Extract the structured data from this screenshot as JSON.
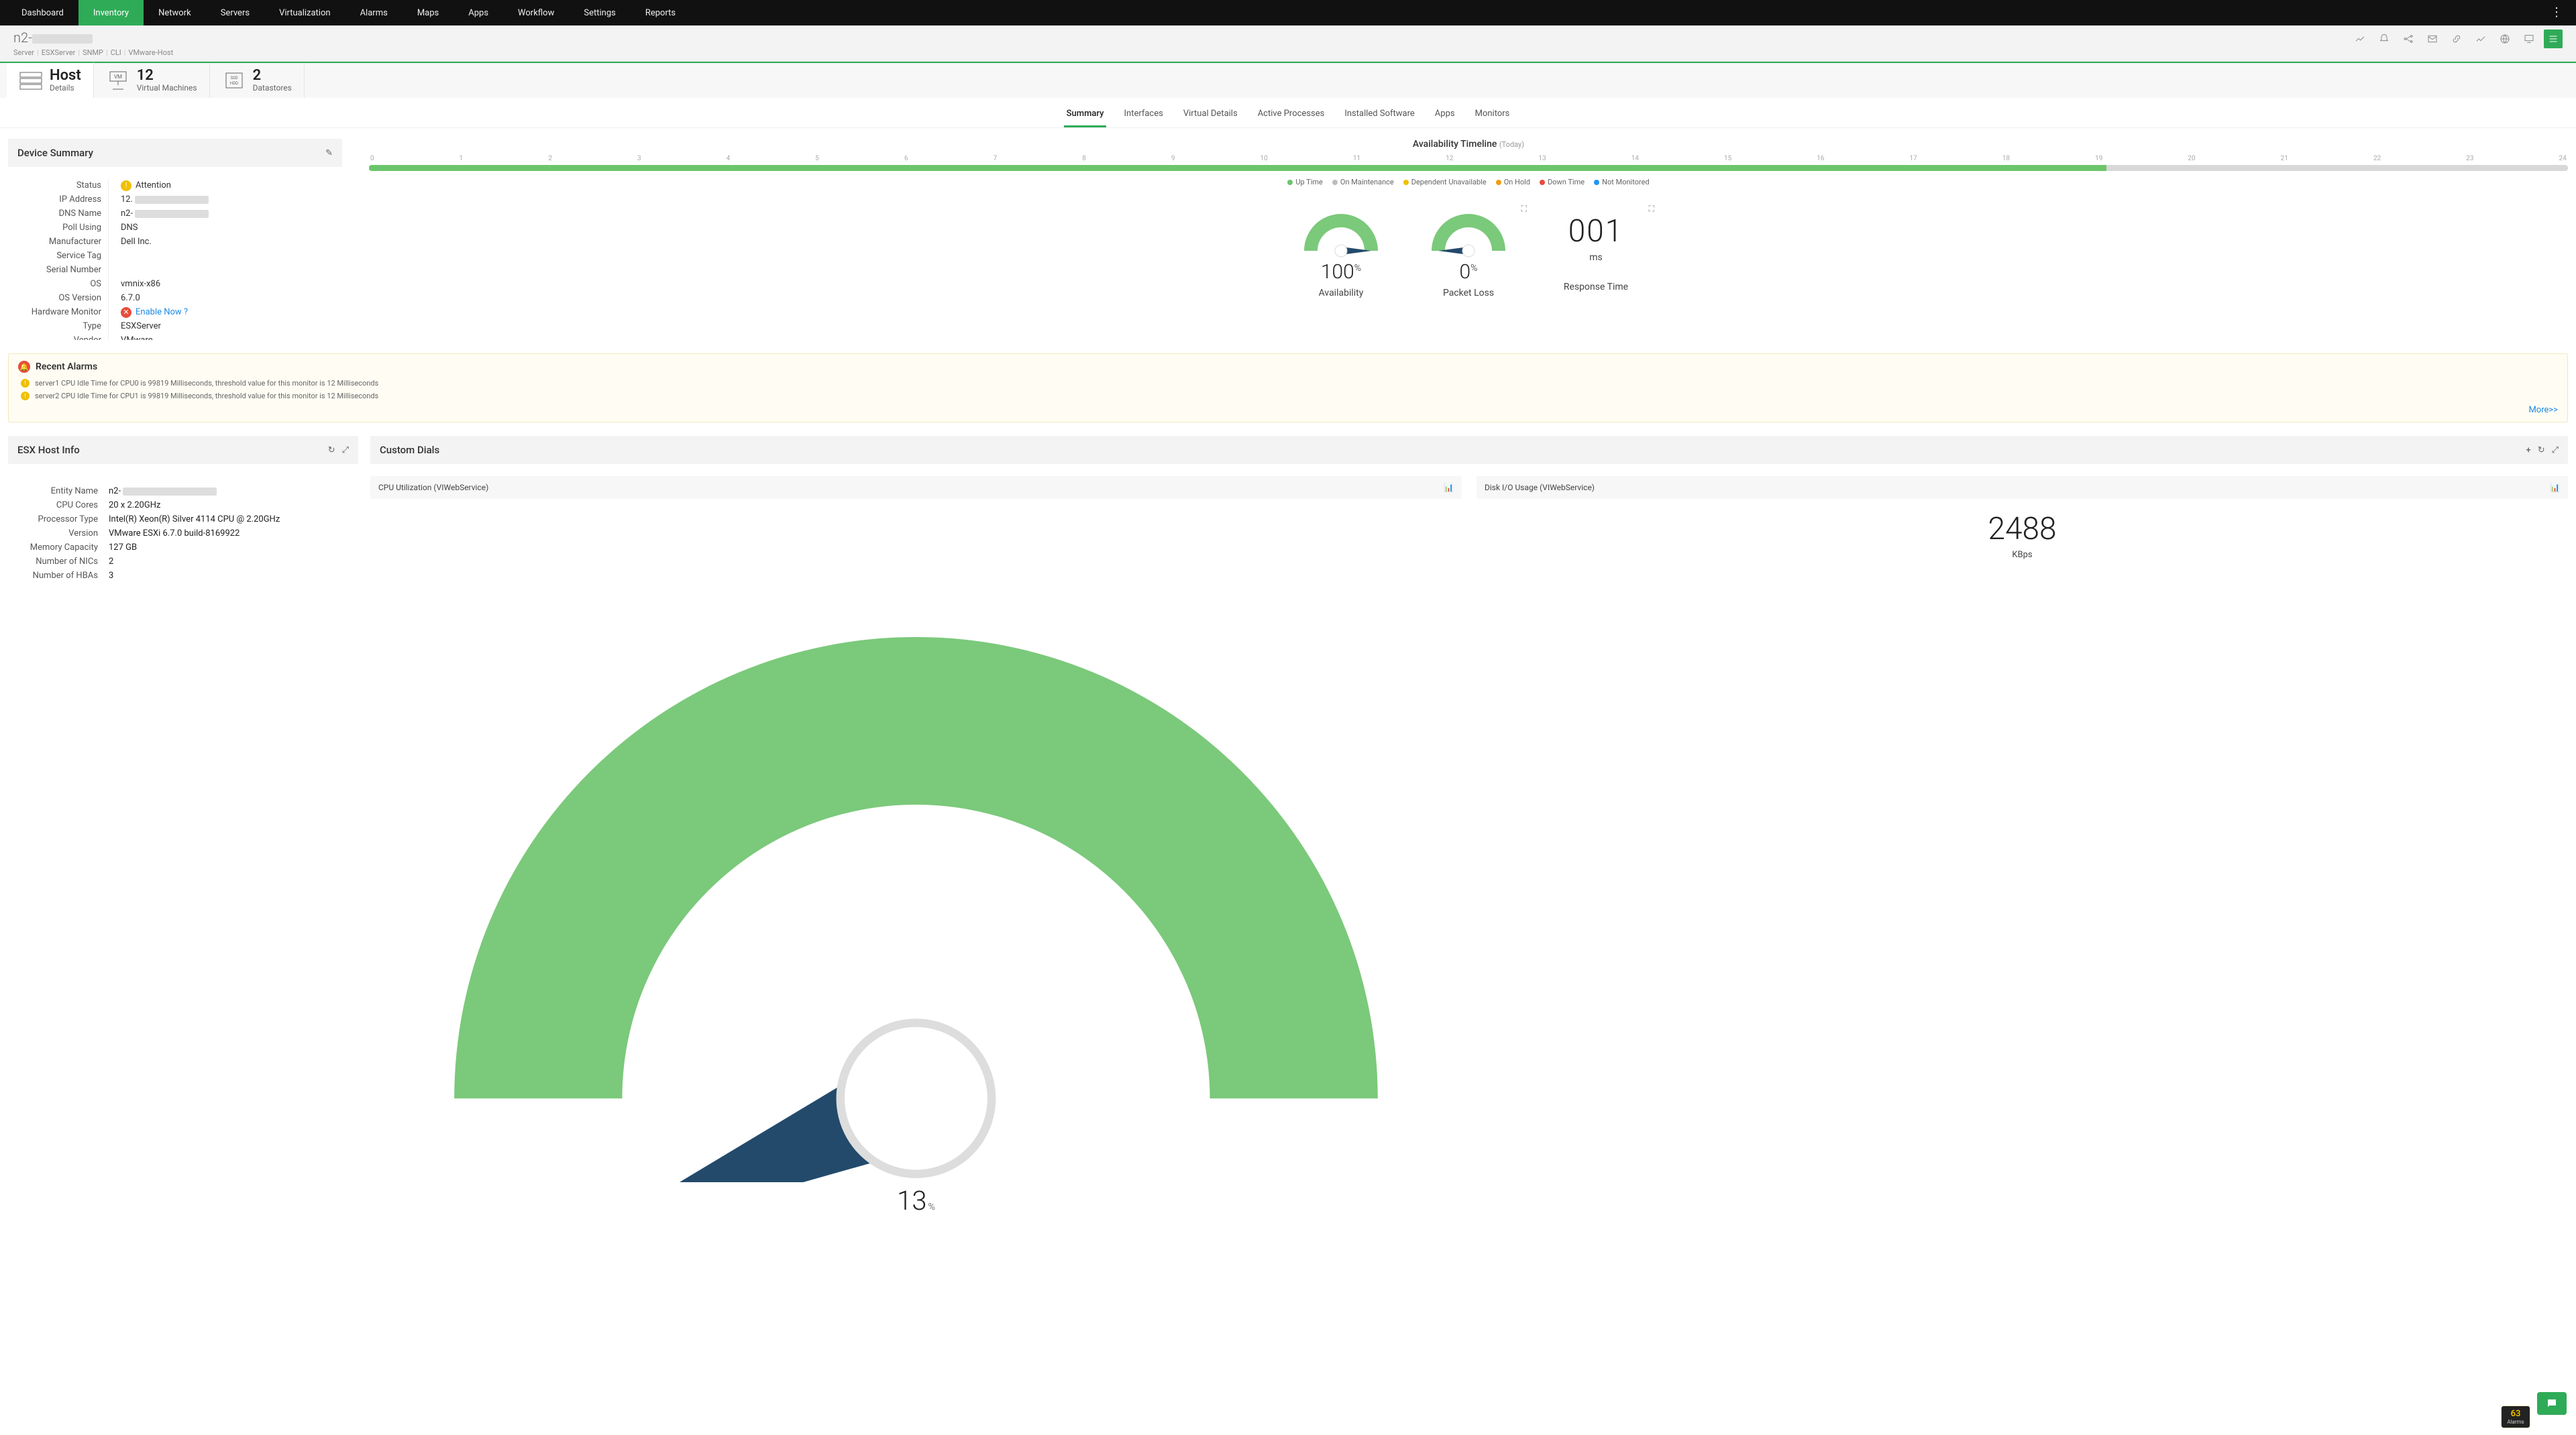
{
  "nav": {
    "items": [
      "Dashboard",
      "Inventory",
      "Network",
      "Servers",
      "Virtualization",
      "Alarms",
      "Maps",
      "Apps",
      "Workflow",
      "Settings",
      "Reports"
    ],
    "active": "Inventory"
  },
  "device": {
    "title_prefix": "n2-",
    "breadcrumb": [
      "Server",
      "ESXServer",
      "SNMP",
      "CLI",
      "VMware-Host"
    ]
  },
  "header_icons": [
    "chart",
    "bell",
    "nodes",
    "mail",
    "link",
    "trend",
    "globe",
    "monitor",
    "menu"
  ],
  "host_tabs": [
    {
      "big": "Host",
      "small": "Details",
      "icon": "server"
    },
    {
      "big": "12",
      "small": "Virtual Machines",
      "icon": "vm"
    },
    {
      "big": "2",
      "small": "Datastores",
      "icon": "disk"
    }
  ],
  "host_tabs_active": 0,
  "subtabs": [
    "Summary",
    "Interfaces",
    "Virtual Details",
    "Active Processes",
    "Installed Software",
    "Apps",
    "Monitors"
  ],
  "subtabs_active": "Summary",
  "panels": {
    "device_summary_title": "Device Summary",
    "esx_title": "ESX Host Info",
    "dials_title": "Custom Dials"
  },
  "status": {
    "label": "Status",
    "value": "Attention",
    "tone": "warn"
  },
  "props": [
    {
      "label": "IP Address",
      "value": "12.",
      "blur": true
    },
    {
      "label": "DNS Name",
      "value": "n2-",
      "blur": true
    },
    {
      "label": "Poll Using",
      "value": "DNS"
    },
    {
      "label": "Manufacturer",
      "value": "Dell Inc."
    },
    {
      "label": "Service Tag",
      "value": ""
    },
    {
      "label": "Serial Number",
      "value": ""
    },
    {
      "label": "OS",
      "value": "vmnix-x86"
    },
    {
      "label": "OS Version",
      "value": "6.7.0"
    },
    {
      "label": "Hardware Monitor",
      "value": "Enable Now ?",
      "link": true,
      "iconred": true
    },
    {
      "label": "Type",
      "value": "ESXServer"
    },
    {
      "label": "Vendor",
      "value": "VMware"
    }
  ],
  "availability": {
    "title": "Availability Timeline",
    "suffix": "(Today)",
    "ticks": [
      "0",
      "1",
      "2",
      "3",
      "4",
      "5",
      "6",
      "7",
      "8",
      "9",
      "10",
      "11",
      "12",
      "13",
      "14",
      "15",
      "16",
      "17",
      "18",
      "19",
      "20",
      "21",
      "22",
      "23",
      "24"
    ],
    "up_pct": 79,
    "legend": [
      {
        "label": "Up Time",
        "color": "#6bc66b"
      },
      {
        "label": "On Maintenance",
        "color": "#bdbdbd"
      },
      {
        "label": "Dependent Unavailable",
        "color": "#f0c000"
      },
      {
        "label": "On Hold",
        "color": "#f39c12"
      },
      {
        "label": "Down Time",
        "color": "#e74c3c"
      },
      {
        "label": "Not Monitored",
        "color": "#2196f3"
      }
    ]
  },
  "gauges": {
    "availability": {
      "value": "100",
      "unit": "%",
      "caption": "Availability",
      "pct": 100
    },
    "packet_loss": {
      "value": "0",
      "unit": "%",
      "caption": "Packet Loss",
      "pct": 0
    },
    "response": {
      "value": "001",
      "unit": "ms",
      "caption": "Response Time"
    }
  },
  "alarms": {
    "title": "Recent Alarms",
    "items": [
      "server1 CPU Idle Time for CPU0 is 99819 Milliseconds, threshold value for this monitor is 12 Milliseconds",
      "server2 CPU Idle Time for CPU1 is 99819 Milliseconds, threshold value for this monitor is 12 Milliseconds"
    ],
    "more": "More>>"
  },
  "esx": [
    {
      "label": "Entity Name",
      "value": "n2-",
      "blur": true
    },
    {
      "label": "CPU Cores",
      "value": "20 x 2.20GHz"
    },
    {
      "label": "Processor Type",
      "value": "Intel(R) Xeon(R) Silver 4114 CPU @ 2.20GHz"
    },
    {
      "label": "Version",
      "value": "VMware ESXi 6.7.0 build-8169922"
    },
    {
      "label": "Memory Capacity",
      "value": "127 GB"
    },
    {
      "label": "Number of NICs",
      "value": "2"
    },
    {
      "label": "Number of HBAs",
      "value": "3"
    }
  ],
  "dials": [
    {
      "title": "CPU Utilization (VIWebService)",
      "value": "13",
      "unit": "%",
      "gauge": true,
      "pct": 13
    },
    {
      "title": "Disk I/O Usage (VIWebService)",
      "value": "2488",
      "unit": "KBps",
      "gauge": false
    }
  ],
  "fab": {
    "alarm_count": "63",
    "alarm_label": "Alarms"
  },
  "chart_data": {
    "type": "other",
    "availability_timeline": {
      "hours": 25,
      "up_fraction": 0.79
    },
    "gauges": [
      {
        "name": "Availability",
        "value": 100,
        "unit": "%"
      },
      {
        "name": "Packet Loss",
        "value": 0,
        "unit": "%"
      },
      {
        "name": "Response Time",
        "value": 1,
        "unit": "ms"
      }
    ],
    "custom_dials": [
      {
        "name": "CPU Utilization (VIWebService)",
        "value": 13,
        "unit": "%"
      },
      {
        "name": "Disk I/O Usage (VIWebService)",
        "value": 2488,
        "unit": "KBps"
      }
    ]
  }
}
